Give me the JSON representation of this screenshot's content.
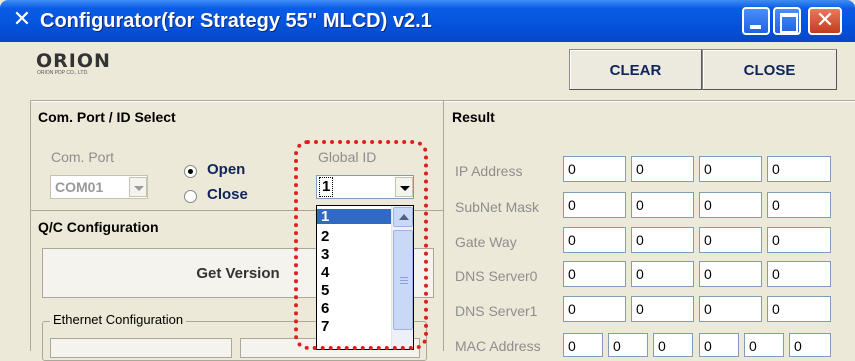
{
  "window": {
    "title": "Configurator(for Strategy 55\" MLCD) v2.1",
    "icon": "tools-icon",
    "controls": [
      "minimize",
      "maximize",
      "close"
    ]
  },
  "toolbar": {
    "logo": "ORION",
    "logo_sub": "ORION PDP CO., LTD.",
    "clear_label": "CLEAR",
    "close_label": "CLOSE"
  },
  "port_panel": {
    "title": "Com. Port / ID Select",
    "com_port_label": "Com. Port",
    "com_port_value": "COM01",
    "open_label": "Open",
    "close_label": "Close",
    "open_selected": true,
    "global_id_label": "Global ID",
    "global_id_value": "1",
    "global_id_options": [
      "1",
      "2",
      "3",
      "4",
      "5",
      "6",
      "7"
    ]
  },
  "qc_panel": {
    "title": "Q/C Configuration",
    "get_version_label": "Get Version",
    "ethernet_label": "Ethernet Configuration"
  },
  "result_panel": {
    "title": "Result",
    "rows": [
      {
        "label": "IP Address",
        "values": [
          "0",
          "0",
          "0",
          "0"
        ]
      },
      {
        "label": "SubNet Mask",
        "values": [
          "0",
          "0",
          "0",
          "0"
        ]
      },
      {
        "label": "Gate Way",
        "values": [
          "0",
          "0",
          "0",
          "0"
        ]
      },
      {
        "label": "DNS Server0",
        "values": [
          "0",
          "0",
          "0",
          "0"
        ]
      },
      {
        "label": "DNS Server1",
        "values": [
          "0",
          "0",
          "0",
          "0"
        ]
      }
    ],
    "mac": {
      "label": "MAC Address",
      "values": [
        "0",
        "0",
        "0",
        "0",
        "0",
        "0"
      ]
    }
  },
  "colors": {
    "titlebar": "#0453dc",
    "highlight": "#e02020",
    "selection": "#316ac5",
    "window_bg": "#ece9d8"
  }
}
